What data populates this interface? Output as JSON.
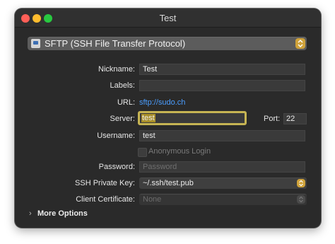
{
  "window": {
    "title": "Test"
  },
  "protocol": {
    "label": "SFTP (SSH File Transfer Protocol)",
    "icon": "drive-icon"
  },
  "form": {
    "nickname_label": "Nickname:",
    "nickname_value": "Test",
    "labels_label": "Labels:",
    "labels_value": "",
    "url_label": "URL:",
    "url_value": "sftp://sudo.ch",
    "server_label": "Server:",
    "server_value": "test",
    "port_label": "Port:",
    "port_value": "22",
    "username_label": "Username:",
    "username_value": "test",
    "anonymous_label": "Anonymous Login",
    "anonymous_checked": false,
    "password_label": "Password:",
    "password_placeholder": "Password",
    "ssh_key_label": "SSH Private Key:",
    "ssh_key_value": "~/.ssh/test.pub",
    "client_cert_label": "Client Certificate:",
    "client_cert_value": "None"
  },
  "more_options": {
    "label": "More Options",
    "expanded": false
  },
  "colors": {
    "accent": "#4a9dff",
    "focus": "#c6b453",
    "stepper": "#cfa23a"
  }
}
